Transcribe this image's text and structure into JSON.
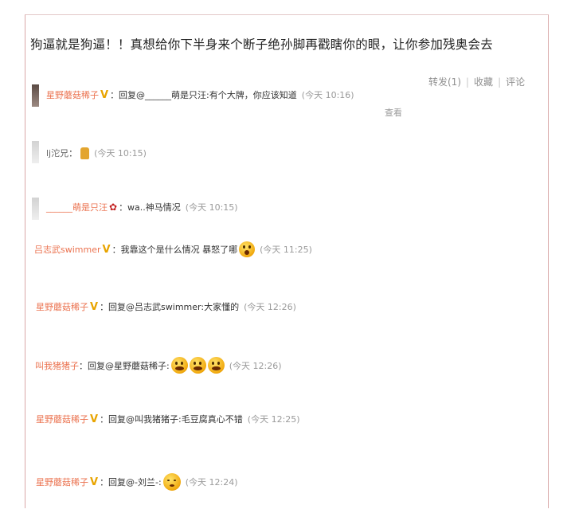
{
  "post": {
    "headline": "狗逼就是狗逼！！真想给你下半身来个断子绝孙脚再戳瞎你的眼，让你参加残奥会去"
  },
  "actions": {
    "repost": "转发(1)",
    "favorite": "收藏",
    "comment": "评论"
  },
  "comments": [
    {
      "user": "星野蘑菇稀子",
      "badge": "V",
      "text": "：回复@______萌是只汪:有个大牌，你应该知道",
      "time": "(今天 10:16)",
      "extra": "查看"
    },
    {
      "user": "lj沱兄",
      "badge": "",
      "text": "：",
      "emoji": "thumbs-up-icon",
      "time": "(今天 10:15)"
    },
    {
      "user": "______萌是只汪",
      "badge": "flower",
      "text": "：wa..神马情况",
      "time": "(今天 10:15)"
    },
    {
      "user": "吕志武swimmer",
      "badge": "V",
      "text": "：我靠这个是什么情况 暴怒了哪",
      "emoji": "surprised-face-icon",
      "time": "(今天 11:25)"
    },
    {
      "user": "星野蘑菇稀子",
      "badge": "V",
      "text": "：回复@吕志武swimmer:大家懂的",
      "time": "(今天 12:26)"
    },
    {
      "user": "叫我猪猪子",
      "badge": "",
      "text": "：回复@星野蘑菇稀子:",
      "emoji": "grin-face-icon x3",
      "time": "(今天 12:26)"
    },
    {
      "user": "星野蘑菇稀子",
      "badge": "V",
      "text": "：回复@叫我猪猪子:毛豆腐真心不错",
      "time": "(今天 12:25)"
    },
    {
      "user": "星野蘑菇稀子",
      "badge": "V",
      "text": "：回复@-刘兰-:",
      "emoji": "sleepy-face-icon",
      "time": "(今天 12:24)"
    }
  ]
}
